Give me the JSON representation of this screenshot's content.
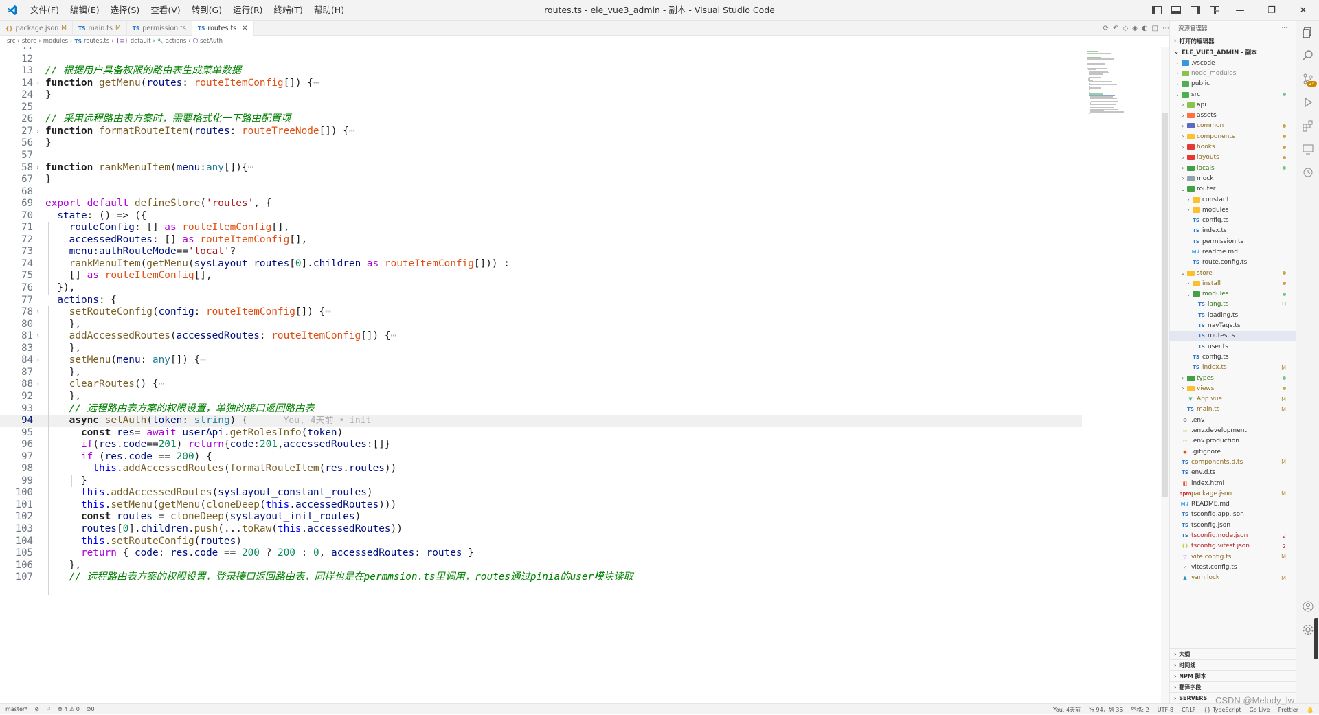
{
  "titlebar": {
    "menus": [
      "文件(F)",
      "编辑(E)",
      "选择(S)",
      "查看(V)",
      "转到(G)",
      "运行(R)",
      "终端(T)",
      "帮助(H)"
    ],
    "title": "routes.ts - ele_vue3_admin - 副本 - Visual Studio Code"
  },
  "tabs": [
    {
      "name": "package.json",
      "badge": "M",
      "icon": "json"
    },
    {
      "name": "main.ts",
      "badge": "M",
      "icon": "ts"
    },
    {
      "name": "permission.ts",
      "badge": "",
      "icon": "ts"
    },
    {
      "name": "routes.ts",
      "badge": "",
      "icon": "ts",
      "active": true
    }
  ],
  "breadcrumb": [
    "src",
    "store",
    "modules",
    "routes.ts",
    "default",
    "actions",
    "setAuth"
  ],
  "editor": {
    "lines": [
      {
        "n": "11",
        "html": ""
      },
      {
        "n": "12",
        "html": ""
      },
      {
        "n": "13",
        "html": "<span class='c'>// 根据用户具备权限的路由表生成菜单数据</span>"
      },
      {
        "n": "14",
        "fold": true,
        "html": "<span class='k' style='color:#1f1f1f;font-weight:bold'>function</span> <span class='fn'>getMenu</span>(<span class='v'>routes</span>: <span class='ty'>routeItemConfig</span>[]) {<span class='ghost'>⋯</span>"
      },
      {
        "n": "24",
        "html": "}"
      },
      {
        "n": "25",
        "html": ""
      },
      {
        "n": "26",
        "html": "<span class='c'>// 采用远程路由表方案时，需要格式化一下路由配置项</span>"
      },
      {
        "n": "27",
        "fold": true,
        "html": "<span class='k' style='color:#1f1f1f;font-weight:bold'>function</span> <span class='fn'>formatRouteItem</span>(<span class='v'>routes</span>: <span class='ty'>routeTreeNode</span>[]) {<span class='ghost'>⋯</span>"
      },
      {
        "n": "56",
        "html": "}"
      },
      {
        "n": "57",
        "html": ""
      },
      {
        "n": "58",
        "fold": true,
        "html": "<span class='k' style='color:#1f1f1f;font-weight:bold'>function</span> <span class='fn'>rankMenuItem</span>(<span class='v'>menu</span>:<span class='tp'>any</span>[]){<span class='ghost'>⋯</span>"
      },
      {
        "n": "67",
        "html": "}"
      },
      {
        "n": "68",
        "html": ""
      },
      {
        "n": "69",
        "html": "<span class='ctl'>export default</span> <span class='fn'>defineStore</span>(<span class='s'>'routes'</span>, {"
      },
      {
        "n": "70",
        "html": "  <span class='v'>state</span>: () => ({"
      },
      {
        "n": "71",
        "html": "    <span class='v'>routeConfig</span>: [] <span class='ctl'>as</span> <span class='ty'>routeItemConfig</span>[],"
      },
      {
        "n": "72",
        "html": "    <span class='v'>accessedRoutes</span>: [] <span class='ctl'>as</span> <span class='ty'>routeItemConfig</span>[],"
      },
      {
        "n": "73",
        "html": "    <span class='v'>menu</span>:<span class='v'>authRouteMode</span>==<span class='s'>'local'</span>?"
      },
      {
        "n": "74",
        "html": "    <span class='fn'>rankMenuItem</span>(<span class='fn'>getMenu</span>(<span class='v'>sysLayout_routes</span>[<span class='n'>0</span>].<span class='v'>children</span> <span class='ctl'>as</span> <span class='ty'>routeItemConfig</span>[])) :"
      },
      {
        "n": "75",
        "html": "    [] <span class='ctl'>as</span> <span class='ty'>routeItemConfig</span>[],"
      },
      {
        "n": "76",
        "html": "  }),"
      },
      {
        "n": "77",
        "html": "  <span class='v'>actions</span>: {"
      },
      {
        "n": "78",
        "fold": true,
        "html": "    <span class='fn'>setRouteConfig</span>(<span class='v'>config</span>: <span class='ty'>routeItemConfig</span>[]) {<span class='ghost'>⋯</span>"
      },
      {
        "n": "80",
        "html": "    },"
      },
      {
        "n": "81",
        "fold": true,
        "html": "    <span class='fn'>addAccessedRoutes</span>(<span class='v'>accessedRoutes</span>: <span class='ty'>routeItemConfig</span>[]) {<span class='ghost'>⋯</span>"
      },
      {
        "n": "83",
        "html": "    },"
      },
      {
        "n": "84",
        "fold": true,
        "html": "    <span class='fn'>setMenu</span>(<span class='v'>menu</span>: <span class='tp'>any</span>[]) {<span class='ghost'>⋯</span>"
      },
      {
        "n": "87",
        "html": "    },"
      },
      {
        "n": "88",
        "fold": true,
        "html": "    <span class='fn'>clearRoutes</span>() {<span class='ghost'>⋯</span>"
      },
      {
        "n": "92",
        "html": "    },"
      },
      {
        "n": "93",
        "html": "    <span class='c'>// 远程路由表方案的权限设置，单独的接口返回路由表</span>"
      },
      {
        "n": "94",
        "cur": true,
        "html": "    <span class='k' style='color:#1f1f1f;font-weight:bold'>async</span> <span class='fn'>setAuth</span>(<span class='v'>token</span>: <span class='tp'>string</span>) {      <span class='ghost' style='font-size:13px'>You, 4天前 • init</span>"
      },
      {
        "n": "95",
        "html": "      <span class='k' style='color:#1f1f1f;font-weight:bold'>const</span> <span class='v'>res</span>= <span class='ctl'>await</span> <span class='v'>userApi</span>.<span class='fn'>getRolesInfo</span>(<span class='v'>token</span>)"
      },
      {
        "n": "96",
        "html": "      <span class='ctl'>if</span>(<span class='v'>res</span>.<span class='v'>code</span>==<span class='n'>201</span>) <span class='ctl'>return</span>{<span class='v'>code</span>:<span class='n'>201</span>,<span class='v'>accessedRoutes</span>:[]}"
      },
      {
        "n": "97",
        "html": "      <span class='ctl'>if</span> (<span class='v'>res</span>.<span class='v'>code</span> == <span class='n'>200</span>) {"
      },
      {
        "n": "98",
        "html": "        <span class='k'>this</span>.<span class='fn'>addAccessedRoutes</span>(<span class='fn'>formatRouteItem</span>(<span class='v'>res</span>.<span class='v'>routes</span>))"
      },
      {
        "n": "99",
        "html": "      }"
      },
      {
        "n": "100",
        "html": "      <span class='k'>this</span>.<span class='fn'>addAccessedRoutes</span>(<span class='v'>sysLayout_constant_routes</span>)"
      },
      {
        "n": "101",
        "html": "      <span class='k'>this</span>.<span class='fn'>setMenu</span>(<span class='fn'>getMenu</span>(<span class='fn'>cloneDeep</span>(<span class='k'>this</span>.<span class='v'>accessedRoutes</span>)))"
      },
      {
        "n": "102",
        "html": "      <span class='k' style='color:#1f1f1f;font-weight:bold'>const</span> <span class='v'>routes</span> = <span class='fn'>cloneDeep</span>(<span class='v'>sysLayout_init_routes</span>)"
      },
      {
        "n": "103",
        "html": "      <span class='v'>routes</span>[<span class='n'>0</span>].<span class='v'>children</span>.<span class='fn'>push</span>(...<span class='fn'>toRaw</span>(<span class='k'>this</span>.<span class='v'>accessedRoutes</span>))"
      },
      {
        "n": "104",
        "html": "      <span class='k'>this</span>.<span class='fn'>setRouteConfig</span>(<span class='v'>routes</span>)"
      },
      {
        "n": "105",
        "html": "      <span class='ctl'>return</span> { <span class='v'>code</span>: <span class='v'>res</span>.<span class='v'>code</span> == <span class='n'>200</span> ? <span class='n'>200</span> : <span class='n'>0</span>, <span class='v'>accessedRoutes</span>: <span class='v'>routes</span> }"
      },
      {
        "n": "106",
        "html": "    },"
      },
      {
        "n": "107",
        "html": "    <span class='c'>// 远程路由表方案的权限设置，登录接口返回路由表，同样也是在permmsion.ts里调用，routes通过pinia的user模块读取</span>"
      }
    ]
  },
  "sidebar": {
    "header": "资源管理器",
    "open_editors": "打开的编辑器",
    "project": "ELE_VUE3_ADMIN - 副本",
    "tree": [
      {
        "label": ".vscode",
        "depth": 1,
        "type": "folder",
        "color": "#3a96dd"
      },
      {
        "label": "node_modules",
        "depth": 1,
        "type": "folder",
        "color": "#8bc34a",
        "dim": true
      },
      {
        "label": "public",
        "depth": 1,
        "type": "folder",
        "color": "#4caf50"
      },
      {
        "label": "src",
        "depth": 1,
        "type": "folder",
        "color": "#4caf50",
        "open": true,
        "dot": "#73c991"
      },
      {
        "label": "api",
        "depth": 2,
        "type": "folder",
        "color": "#8bc34a"
      },
      {
        "label": "assets",
        "depth": 2,
        "type": "folder",
        "color": "#ff7043"
      },
      {
        "label": "common",
        "depth": 2,
        "type": "folder",
        "color": "#5c6bc0",
        "textcolor": "#8a6a1f",
        "dot": "#c9a64a"
      },
      {
        "label": "components",
        "depth": 2,
        "type": "folder",
        "color": "#fbc02d",
        "textcolor": "#8a6a1f",
        "dot": "#c9a64a"
      },
      {
        "label": "hooks",
        "depth": 2,
        "type": "folder",
        "color": "#e53935",
        "textcolor": "#8a6a1f",
        "dot": "#c9a64a"
      },
      {
        "label": "layouts",
        "depth": 2,
        "type": "folder",
        "color": "#e53935",
        "textcolor": "#8a6a1f",
        "dot": "#c9a64a"
      },
      {
        "label": "locals",
        "depth": 2,
        "type": "folder",
        "color": "#43a047",
        "textcolor": "#38761d",
        "dot": "#73c991"
      },
      {
        "label": "mock",
        "depth": 2,
        "type": "folder",
        "color": "#90a4ae"
      },
      {
        "label": "router",
        "depth": 2,
        "type": "folder",
        "color": "#43a047",
        "open": true
      },
      {
        "label": "constant",
        "depth": 3,
        "type": "folder",
        "color": "#fbc02d"
      },
      {
        "label": "modules",
        "depth": 3,
        "type": "folder",
        "color": "#fbc02d"
      },
      {
        "label": "config.ts",
        "depth": 3,
        "type": "ts"
      },
      {
        "label": "index.ts",
        "depth": 3,
        "type": "ts"
      },
      {
        "label": "permission.ts",
        "depth": 3,
        "type": "ts"
      },
      {
        "label": "readme.md",
        "depth": 3,
        "type": "md"
      },
      {
        "label": "route.config.ts",
        "depth": 3,
        "type": "ts"
      },
      {
        "label": "store",
        "depth": 2,
        "type": "folder",
        "color": "#fbc02d",
        "open": true,
        "textcolor": "#8a6a1f",
        "dot": "#c9a64a"
      },
      {
        "label": "install",
        "depth": 3,
        "type": "folder",
        "color": "#fbc02d",
        "textcolor": "#8a6a1f",
        "dot": "#c9a64a"
      },
      {
        "label": "modules",
        "depth": 3,
        "type": "folder",
        "color": "#43a047",
        "open": true,
        "textcolor": "#38761d",
        "dot": "#73c991"
      },
      {
        "label": "lang.ts",
        "depth": 4,
        "type": "ts",
        "textcolor": "#38761d",
        "badge": "U",
        "badgecolor": "#38761d"
      },
      {
        "label": "loading.ts",
        "depth": 4,
        "type": "ts"
      },
      {
        "label": "navTags.ts",
        "depth": 4,
        "type": "ts"
      },
      {
        "label": "routes.ts",
        "depth": 4,
        "type": "ts",
        "selected": true
      },
      {
        "label": "user.ts",
        "depth": 4,
        "type": "ts"
      },
      {
        "label": "config.ts",
        "depth": 3,
        "type": "ts"
      },
      {
        "label": "index.ts",
        "depth": 3,
        "type": "ts",
        "textcolor": "#8a6a1f",
        "badge": "M"
      },
      {
        "label": "types",
        "depth": 2,
        "type": "folder",
        "color": "#43a047",
        "textcolor": "#38761d",
        "dot": "#73c991"
      },
      {
        "label": "views",
        "depth": 2,
        "type": "folder",
        "color": "#fbc02d",
        "textcolor": "#8a6a1f",
        "dot": "#c9a64a"
      },
      {
        "label": "App.vue",
        "depth": 2,
        "type": "vue",
        "textcolor": "#8a6a1f",
        "badge": "M"
      },
      {
        "label": "main.ts",
        "depth": 2,
        "type": "ts",
        "textcolor": "#8a6a1f",
        "badge": "M"
      },
      {
        "label": ".env",
        "depth": 1,
        "type": "gear"
      },
      {
        "label": ".env.development",
        "depth": 1,
        "type": "env"
      },
      {
        "label": ".env.production",
        "depth": 1,
        "type": "env"
      },
      {
        "label": ".gitignore",
        "depth": 1,
        "type": "git"
      },
      {
        "label": "components.d.ts",
        "depth": 1,
        "type": "ts",
        "textcolor": "#8a6a1f",
        "badge": "M"
      },
      {
        "label": "env.d.ts",
        "depth": 1,
        "type": "ts"
      },
      {
        "label": "index.html",
        "depth": 1,
        "type": "html"
      },
      {
        "label": "package.json",
        "depth": 1,
        "type": "npm",
        "textcolor": "#8a6a1f",
        "badge": "M"
      },
      {
        "label": "README.md",
        "depth": 1,
        "type": "md"
      },
      {
        "label": "tsconfig.app.json",
        "depth": 1,
        "type": "ts"
      },
      {
        "label": "tsconfig.json",
        "depth": 1,
        "type": "ts"
      },
      {
        "label": "tsconfig.node.json",
        "depth": 1,
        "type": "ts",
        "textcolor": "#b22222",
        "badge": "2",
        "badgecolor": "#b22222"
      },
      {
        "label": "tsconfig.vitest.json",
        "depth": 1,
        "type": "json",
        "textcolor": "#b22222",
        "badge": "2",
        "badgecolor": "#b22222"
      },
      {
        "label": "vite.config.ts",
        "depth": 1,
        "type": "vite",
        "textcolor": "#8a6a1f",
        "badge": "M"
      },
      {
        "label": "vitest.config.ts",
        "depth": 1,
        "type": "vitest"
      },
      {
        "label": "yarn.lock",
        "depth": 1,
        "type": "yarn",
        "textcolor": "#8a6a1f",
        "badge": "M"
      }
    ],
    "bottom": [
      "大纲",
      "时间线",
      "NPM 脚本",
      "翻译字段",
      "SERVERS"
    ]
  },
  "statusbar": {
    "left": [
      "master*",
      "⊘",
      "⚐",
      "⊗ 4 ⚠ 0",
      "⊘0"
    ],
    "right": [
      "You, 4天前",
      "行 94，列 35",
      "空格: 2",
      "UTF-8",
      "CRLF",
      "{} TypeScript",
      "Go Live",
      "Prettier"
    ]
  },
  "watermark": "CSDN @Melody_lw"
}
